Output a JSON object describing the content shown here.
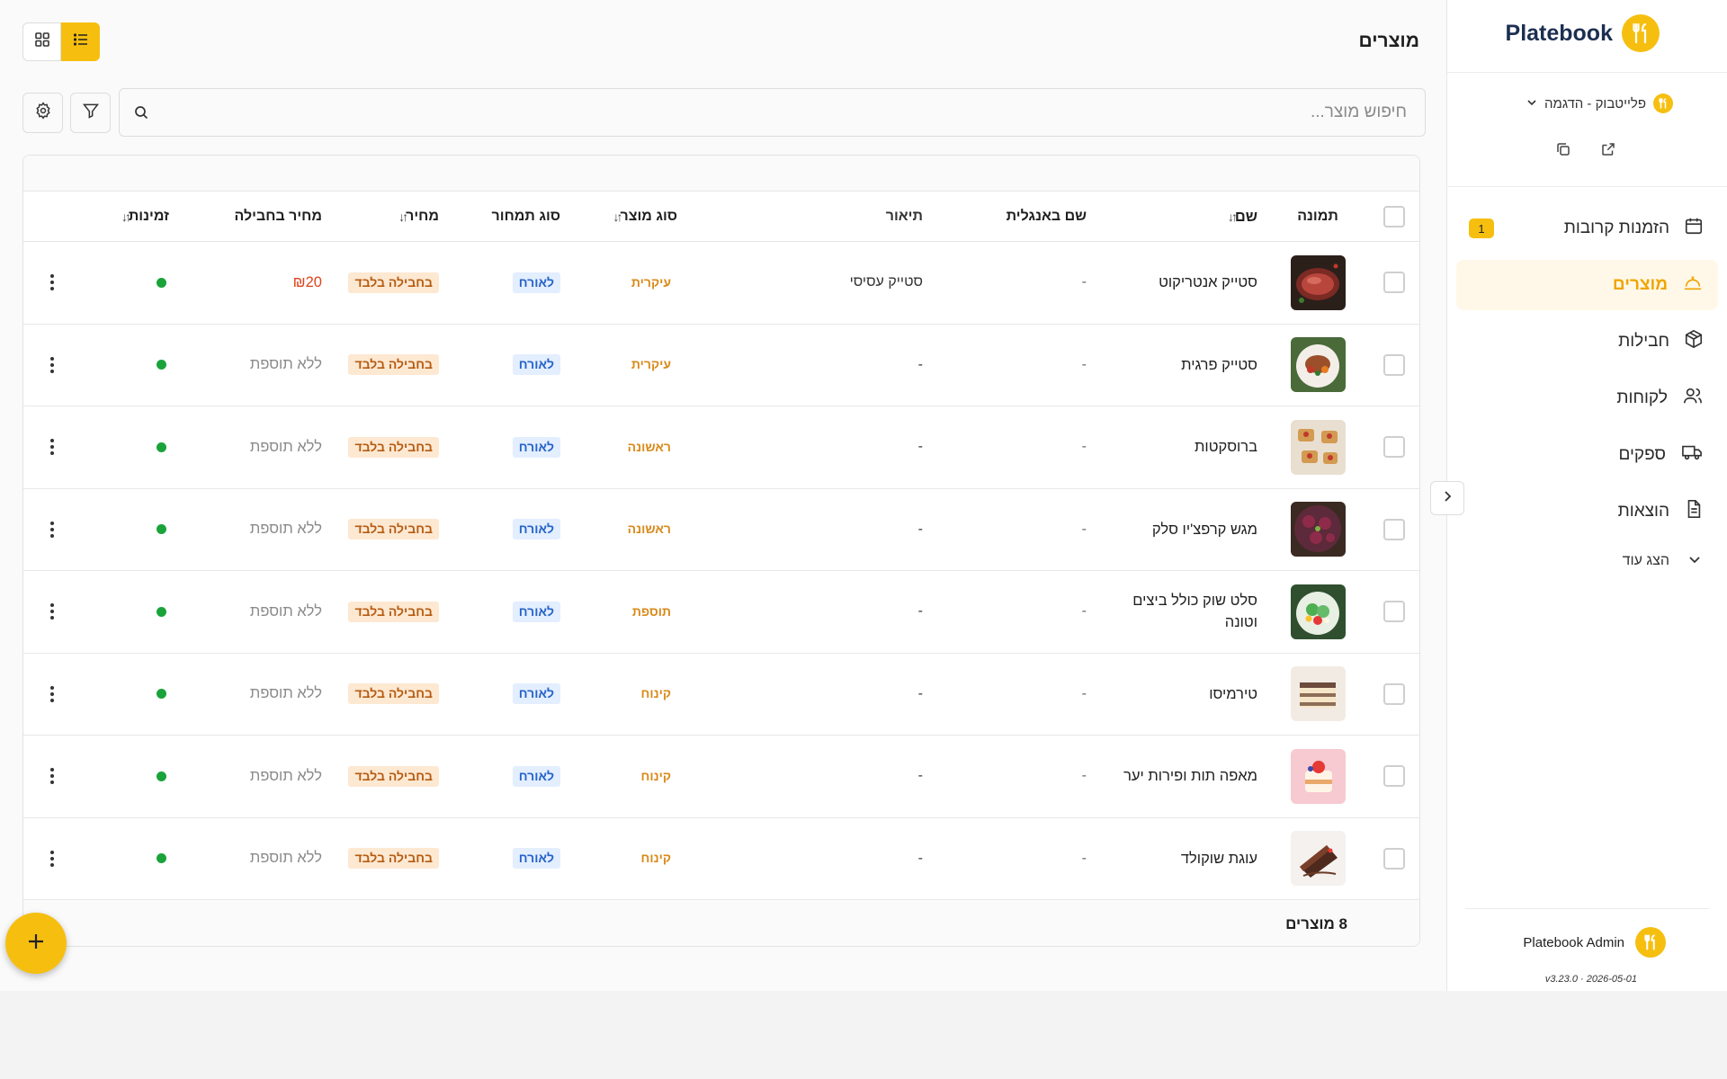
{
  "brand": {
    "name": "Platebook"
  },
  "restaurant": {
    "name": "פלייטבוק - הדגמה"
  },
  "nav": {
    "items": [
      {
        "label": "הזמנות קרובות",
        "badge": "1",
        "icon": "calendar-icon",
        "active": false
      },
      {
        "label": "מוצרים",
        "badge": "",
        "icon": "cloche-icon",
        "active": true
      },
      {
        "label": "חבילות",
        "badge": "",
        "icon": "box-icon",
        "active": false
      },
      {
        "label": "לקוחות",
        "badge": "",
        "icon": "users-icon",
        "active": false
      },
      {
        "label": "ספקים",
        "badge": "",
        "icon": "truck-icon",
        "active": false
      },
      {
        "label": "הוצאות",
        "badge": "",
        "icon": "document-icon",
        "active": false
      }
    ],
    "more_label": "הצג עוד"
  },
  "user": {
    "name": "Platebook Admin",
    "version": "v3.23.0 · 2026-05-01"
  },
  "page": {
    "title": "מוצרים"
  },
  "search": {
    "placeholder": "חיפוש מוצר..."
  },
  "table": {
    "headers": {
      "image": "תמונה",
      "name": "שם",
      "english_name": "שם באנגלית",
      "description": "תיאור",
      "product_type": "סוג מוצר",
      "kitchen_type": "סוג תמחור",
      "price": "מחיר",
      "package_price": "מחיר בחבילה",
      "availability": "זמינות"
    },
    "rows": [
      {
        "name": "סטייק אנטריקוט",
        "english_name": "-",
        "description": "סטייק עסיסי",
        "product_type": "עיקרית",
        "kitchen_type": "לאורח",
        "price": "בחבילה בלבד",
        "package_price": "₪20",
        "available": true,
        "img": "steak"
      },
      {
        "name": "סטייק פרגית",
        "english_name": "-",
        "description": "-",
        "product_type": "עיקרית",
        "kitchen_type": "לאורח",
        "price": "בחבילה בלבד",
        "package_price": "ללא תוספת",
        "available": true,
        "img": "plate"
      },
      {
        "name": "ברוסקטות",
        "english_name": "-",
        "description": "-",
        "product_type": "ראשונה",
        "kitchen_type": "לאורח",
        "price": "בחבילה בלבד",
        "package_price": "ללא תוספת",
        "available": true,
        "img": "bruschetta"
      },
      {
        "name": "מגש קרפצ'יו סלק",
        "english_name": "-",
        "description": "-",
        "product_type": "ראשונה",
        "kitchen_type": "לאורח",
        "price": "בחבילה בלבד",
        "package_price": "ללא תוספת",
        "available": true,
        "img": "carpaccio"
      },
      {
        "name": "סלט שוק כולל ביצים וטונה",
        "english_name": "-",
        "description": "-",
        "product_type": "תוספת",
        "kitchen_type": "לאורח",
        "price": "בחבילה בלבד",
        "package_price": "ללא תוספת",
        "available": true,
        "img": "salad"
      },
      {
        "name": "טירמיסו",
        "english_name": "-",
        "description": "-",
        "product_type": "קינוח",
        "kitchen_type": "לאורח",
        "price": "בחבילה בלבד",
        "package_price": "ללא תוספת",
        "available": true,
        "img": "tiramisu"
      },
      {
        "name": "מאפה תות ופירות יער",
        "english_name": "-",
        "description": "-",
        "product_type": "קינוח",
        "kitchen_type": "לאורח",
        "price": "בחבילה בלבד",
        "package_price": "ללא תוספת",
        "available": true,
        "img": "pastry"
      },
      {
        "name": "עוגת שוקולד",
        "english_name": "-",
        "description": "-",
        "product_type": "קינוח",
        "kitchen_type": "לאורח",
        "price": "בחבילה בלבד",
        "package_price": "ללא תוספת",
        "available": true,
        "img": "chocolate"
      }
    ],
    "footer_count": "8 מוצרים"
  },
  "colors": {
    "accent": "#f6bf10",
    "brand_text": "#1c2f52",
    "active_nav": "#f0a500",
    "available": "#1aa33a",
    "price_red": "#e0431c"
  }
}
